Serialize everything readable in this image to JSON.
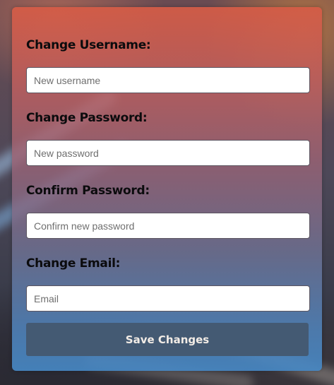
{
  "form": {
    "username": {
      "label": "Change Username:",
      "placeholder": "New username",
      "value": ""
    },
    "password": {
      "label": "Change Password:",
      "placeholder": "New password",
      "value": ""
    },
    "confirm_password": {
      "label": "Confirm Password:",
      "placeholder": "Confirm new password",
      "value": ""
    },
    "email": {
      "label": "Change Email:",
      "placeholder": "Email",
      "value": ""
    },
    "save_label": "Save Changes"
  },
  "colors": {
    "card_top": "#d65c46",
    "card_bottom": "#4687c3",
    "button_bg": "#445a73",
    "button_text": "#f2ece6",
    "label_text": "#0b0b0d"
  }
}
